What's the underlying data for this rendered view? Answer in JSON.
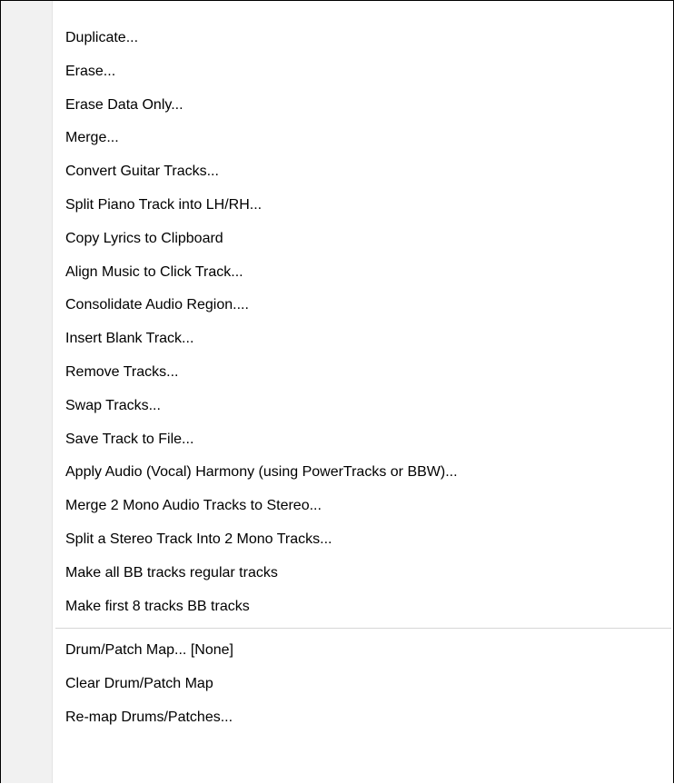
{
  "menu": {
    "group1": [
      "Duplicate...",
      "Erase...",
      "Erase Data Only...",
      "Merge...",
      "Convert Guitar Tracks...",
      "Split Piano Track into LH/RH...",
      "Copy Lyrics to Clipboard",
      "Align Music to Click Track...",
      "Consolidate Audio Region....",
      "Insert Blank Track...",
      "Remove Tracks...",
      "Swap Tracks...",
      "Save Track to File...",
      "Apply Audio (Vocal) Harmony (using PowerTracks or BBW)...",
      "Merge 2 Mono Audio Tracks to Stereo...",
      "Split a Stereo Track Into 2 Mono Tracks...",
      "Make all BB tracks regular tracks",
      "Make first 8 tracks BB tracks"
    ],
    "group2": [
      "Drum/Patch Map... [None]",
      "Clear Drum/Patch Map",
      "Re-map Drums/Patches..."
    ]
  },
  "colors": {
    "border": "#000000",
    "gutter": "#f1f1f1",
    "separator": "#d7d7d7",
    "background": "#ffffff"
  }
}
